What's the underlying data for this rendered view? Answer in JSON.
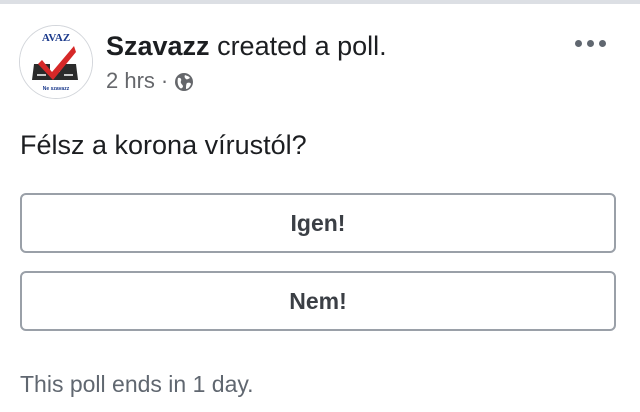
{
  "post": {
    "author": "Szavazz",
    "action": " created a poll.",
    "time": "2 hrs",
    "separator": "·",
    "privacy_icon": "globe-icon",
    "menu_icon": "more-options-icon",
    "avatar_logo_text_top": "AVAZ",
    "avatar_logo_text_bottom": "Ne szavazz"
  },
  "poll": {
    "question": "Félsz a korona vírustól?",
    "options": [
      "Igen!",
      "Nem!"
    ],
    "footer": "This poll ends in 1 day."
  },
  "colors": {
    "logo_red": "#d62828",
    "logo_dark": "#222222",
    "logo_blue": "#1b3a8c",
    "meta_gray": "#65676b",
    "option_border": "#9aa0a8"
  }
}
